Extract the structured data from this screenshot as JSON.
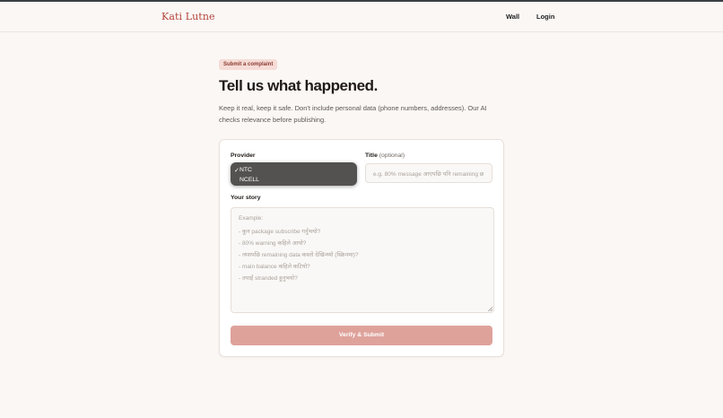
{
  "header": {
    "brand": "Kati Lutne",
    "nav": [
      {
        "label": "Wall"
      },
      {
        "label": "Login"
      }
    ]
  },
  "page": {
    "badge": "Submit a complaint",
    "title": "Tell us what happened.",
    "subtitle": "Keep it real, keep it safe. Don't include personal data (phone numbers, addresses). Our AI checks relevance before publishing."
  },
  "form": {
    "provider": {
      "label": "Provider",
      "options": [
        "NTC",
        "NCELL"
      ],
      "selected": "NTC",
      "check_glyph": "✓"
    },
    "title_field": {
      "label": "Title",
      "optional": "(optional)",
      "placeholder": "e.g. 80% message आएपछि पनि remaining छ"
    },
    "story": {
      "label": "Your story",
      "placeholder_lines": [
        "Example:",
        "- कुन package subscribe गर्नुभयो?",
        "- 80% warning कहिले आयो?",
        "- त्यसपछि remaining data कस्तो देखिन्थ्यो (स्क्रिनमा)?",
        "- main balance कहिले कटियो?",
        "- तपाईं stranded हुनुभयो?"
      ]
    },
    "submit_label": "Verify & Submit"
  },
  "colors": {
    "brand": "#b4443a",
    "badge_bg": "#f6dcd6",
    "submit_bg": "#dea29b",
    "dropdown_bg": "#545250"
  }
}
